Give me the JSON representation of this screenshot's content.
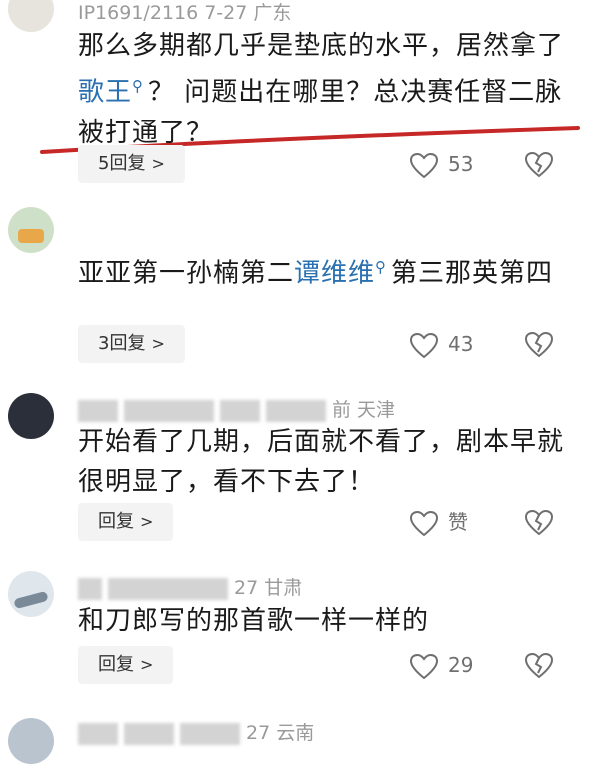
{
  "comments": [
    {
      "meta": "IP1691/2116 7-27 广东",
      "body_pre": "那么多期都几乎是垫底的水平，居然拿了",
      "body_link": "歌王",
      "body_post": "？ 问题出在哪里？总决赛任督二脉被打通了？",
      "reply_label": "5回复",
      "like_count": "53"
    },
    {
      "meta": "",
      "body_pre": "亚亚第一孙楠第二",
      "body_link": "谭维维",
      "body_post": "第三那英第四",
      "reply_label": "3回复",
      "like_count": "43"
    },
    {
      "meta": "前 天津",
      "body": "开始看了几期，后面就不看了，剧本早就很明显了，看不下去了！",
      "reply_label": "回复",
      "like_count": "赞"
    },
    {
      "meta": "27 甘肃",
      "body": "和刀郎写的那首歌一样一样的",
      "reply_label": "回复",
      "like_count": "29"
    },
    {
      "meta": "27 云南"
    }
  ],
  "colors": {
    "link": "#2a6fb0",
    "underline": "#c62828",
    "reply_bg": "#f3f3f3"
  },
  "icons": {
    "search_hint": "search-icon",
    "like": "heart-outline-icon",
    "dislike": "broken-heart-icon",
    "chevron": "chevron-right-icon"
  }
}
